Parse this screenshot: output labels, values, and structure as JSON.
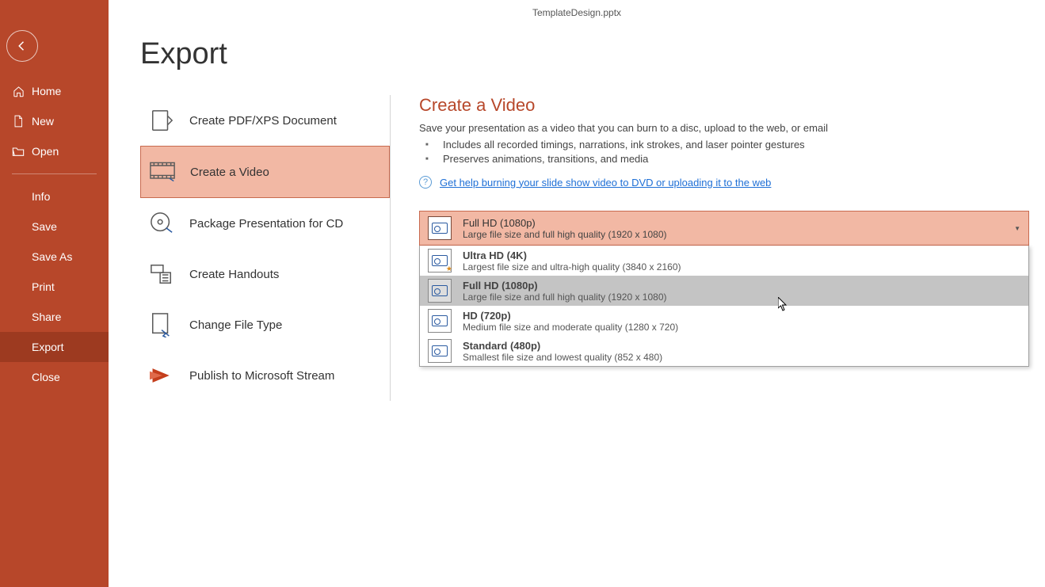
{
  "titlebar": {
    "filename": "TemplateDesign.pptx"
  },
  "page": {
    "title": "Export"
  },
  "sidebar": {
    "items": [
      {
        "label": "Home"
      },
      {
        "label": "New"
      },
      {
        "label": "Open"
      },
      {
        "label": "Info"
      },
      {
        "label": "Save"
      },
      {
        "label": "Save As"
      },
      {
        "label": "Print"
      },
      {
        "label": "Share"
      },
      {
        "label": "Export"
      },
      {
        "label": "Close"
      }
    ]
  },
  "export_options": [
    {
      "label": "Create PDF/XPS Document"
    },
    {
      "label": "Create a Video"
    },
    {
      "label": "Package Presentation for CD"
    },
    {
      "label": "Create Handouts"
    },
    {
      "label": "Change File Type"
    },
    {
      "label": "Publish to Microsoft Stream"
    }
  ],
  "detail": {
    "title": "Create a Video",
    "subtitle": "Save your presentation as a video that you can burn to a disc, upload to the web, or email",
    "bullets": [
      "Includes all recorded timings, narrations, ink strokes, and laser pointer gestures",
      "Preserves animations, transitions, and media"
    ],
    "help_link": "Get help burning your slide show video to DVD or uploading it to the web"
  },
  "quality_dropdown": {
    "selected": {
      "title": "Full HD (1080p)",
      "desc": "Large file size and full high quality (1920 x 1080)"
    },
    "options": [
      {
        "title": "Ultra HD (4K)",
        "desc": "Largest file size and ultra-high quality (3840 x 2160)"
      },
      {
        "title": "Full HD (1080p)",
        "desc": "Large file size and full high quality (1920 x 1080)"
      },
      {
        "title": "HD (720p)",
        "desc": "Medium file size and moderate quality (1280 x 720)"
      },
      {
        "title": "Standard (480p)",
        "desc": "Smallest file size and lowest quality (852 x 480)"
      }
    ]
  }
}
